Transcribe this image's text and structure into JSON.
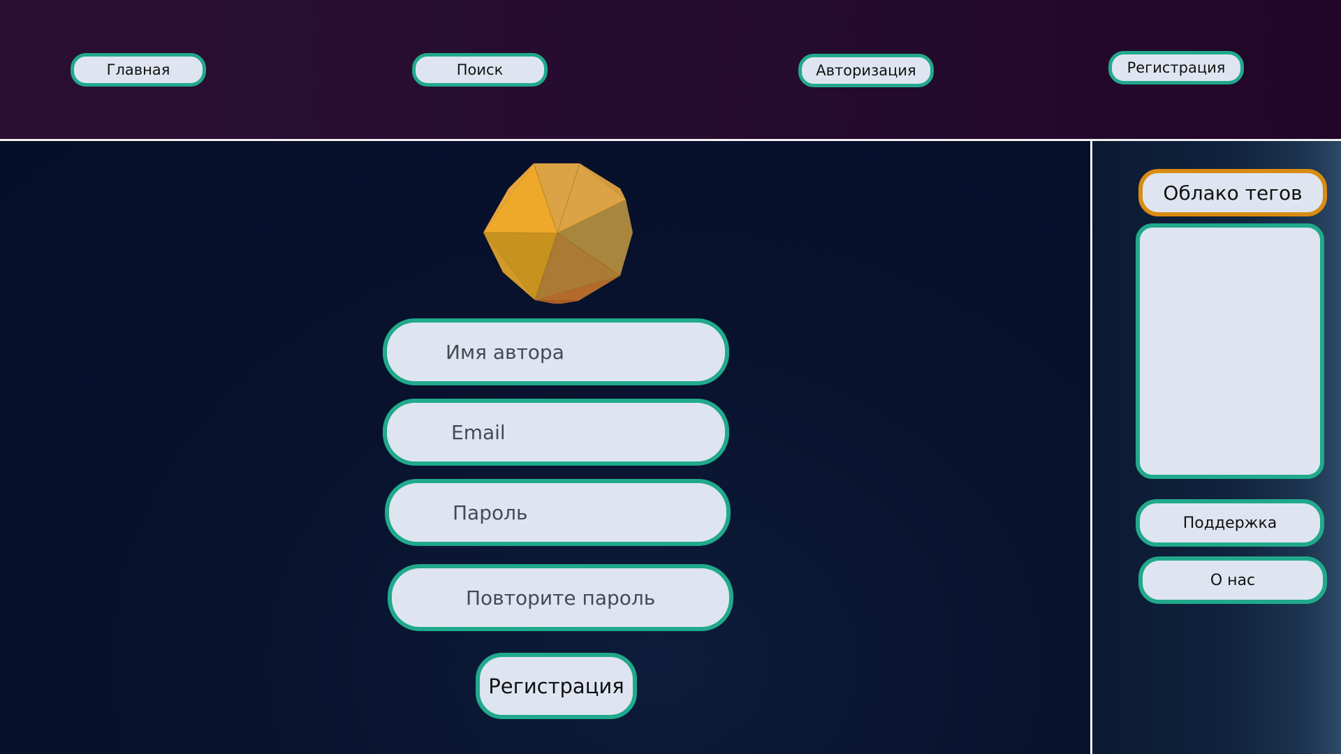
{
  "nav": {
    "home": "Главная",
    "search": "Поиск",
    "login": "Авторизация",
    "register": "Регистрация"
  },
  "form": {
    "author_name_placeholder": "Имя автора",
    "email_placeholder": "Email",
    "password_placeholder": "Пароль",
    "repeat_password_placeholder": "Повторите пароль",
    "submit_label": "Регистрация"
  },
  "sidebar": {
    "tag_cloud_title": "Облако тегов",
    "support_label": "Поддержка",
    "about_label": "О нас"
  },
  "colors": {
    "accent_teal": "#21a98c",
    "accent_orange": "#d98c12",
    "field_bg": "#dfe5f0",
    "header_bg": "#2a0f33",
    "main_bg": "#08132e"
  },
  "icons": {
    "logo": "polyhedron-logo-icon"
  }
}
